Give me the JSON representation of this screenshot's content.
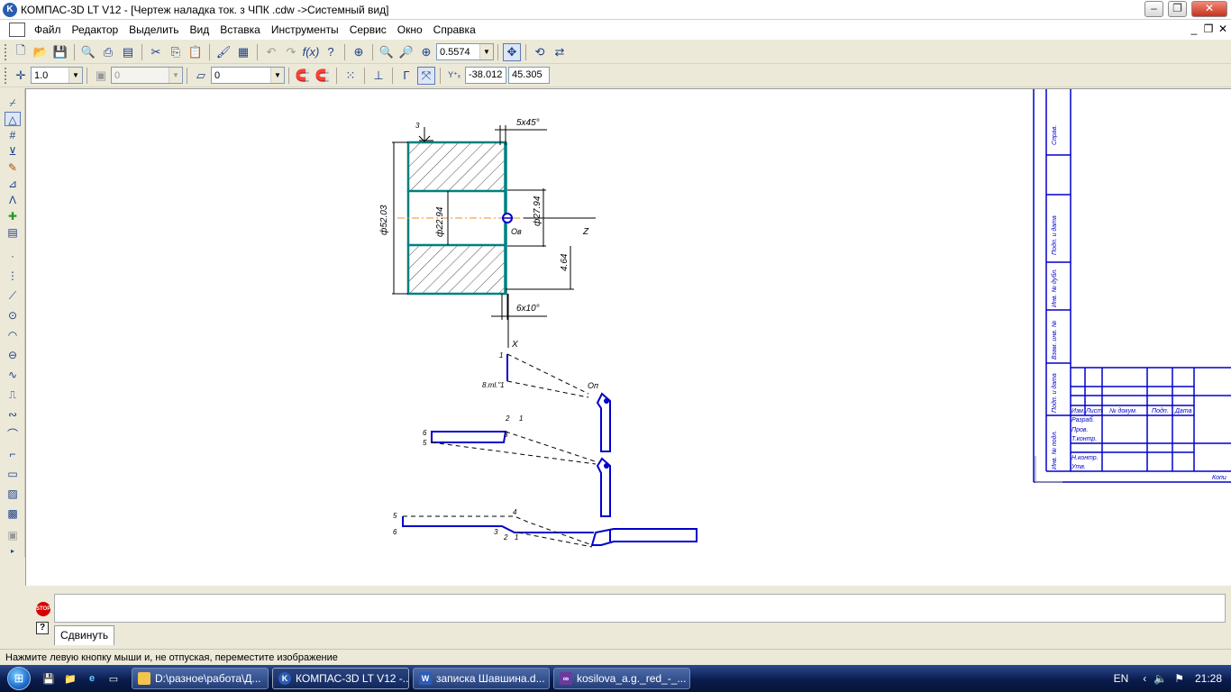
{
  "window": {
    "title": "КОМПАС-3D LT V12 - [Чертеж наладка ток. з ЧПК .cdw ->Системный вид]",
    "logo": "K"
  },
  "menu": [
    "Файл",
    "Редактор",
    "Выделить",
    "Вид",
    "Вставка",
    "Инструменты",
    "Сервис",
    "Окно",
    "Справка"
  ],
  "toolbar1": {
    "zoom": "0.5574"
  },
  "toolbar2": {
    "step": "1.0",
    "layer_state": "0",
    "style": "0",
    "x_coord": "-38.012",
    "y_coord": "45.305"
  },
  "drawing": {
    "dims": {
      "chamfer_top": "5x45°",
      "chamfer_bot": "6x10°",
      "d_outer": "ф52.03",
      "d_inner": "ф22.94",
      "d_face": "ф27.94",
      "len": "4.64",
      "origin": "Oв",
      "axis_z": "Z",
      "axis_x": "X",
      "pt3": "3",
      "tool_origin": "Oп"
    },
    "path_labels": {
      "p1": "1",
      "p2": "2",
      "p3": "3",
      "p4": "4",
      "p5": "5",
      "p6": "6",
      "ref": "8.ml.\"1"
    },
    "title_block": {
      "h1": "Изм.",
      "h2": "Лист",
      "h3": "№ докум.",
      "h4": "Подп.",
      "h5": "Дата",
      "r1": "Разраб.",
      "r2": "Пров.",
      "r3": "Т.контр.",
      "r4": "Н.контр.",
      "r5": "Утв.",
      "side1": "Справ.",
      "side2": "Подп. и дата",
      "side3": "Инв. № дубл.",
      "side4": "Взам. инв. №",
      "side5": "Подп. и дата",
      "side6": "Инв. № подл.",
      "copy": "Копи"
    }
  },
  "command": {
    "tab": "Сдвинуть"
  },
  "status": "Нажмите левую кнопку мыши и, не отпуская, переместите изображение",
  "taskbar": {
    "lang": "EN",
    "clock": "21:28",
    "tasks": [
      "D:\\разное\\работа\\Д...",
      "КОМПАС-3D LT V12 -...",
      "записка Шавшина.d...",
      "kosilova_a.g._red_-_..."
    ]
  }
}
